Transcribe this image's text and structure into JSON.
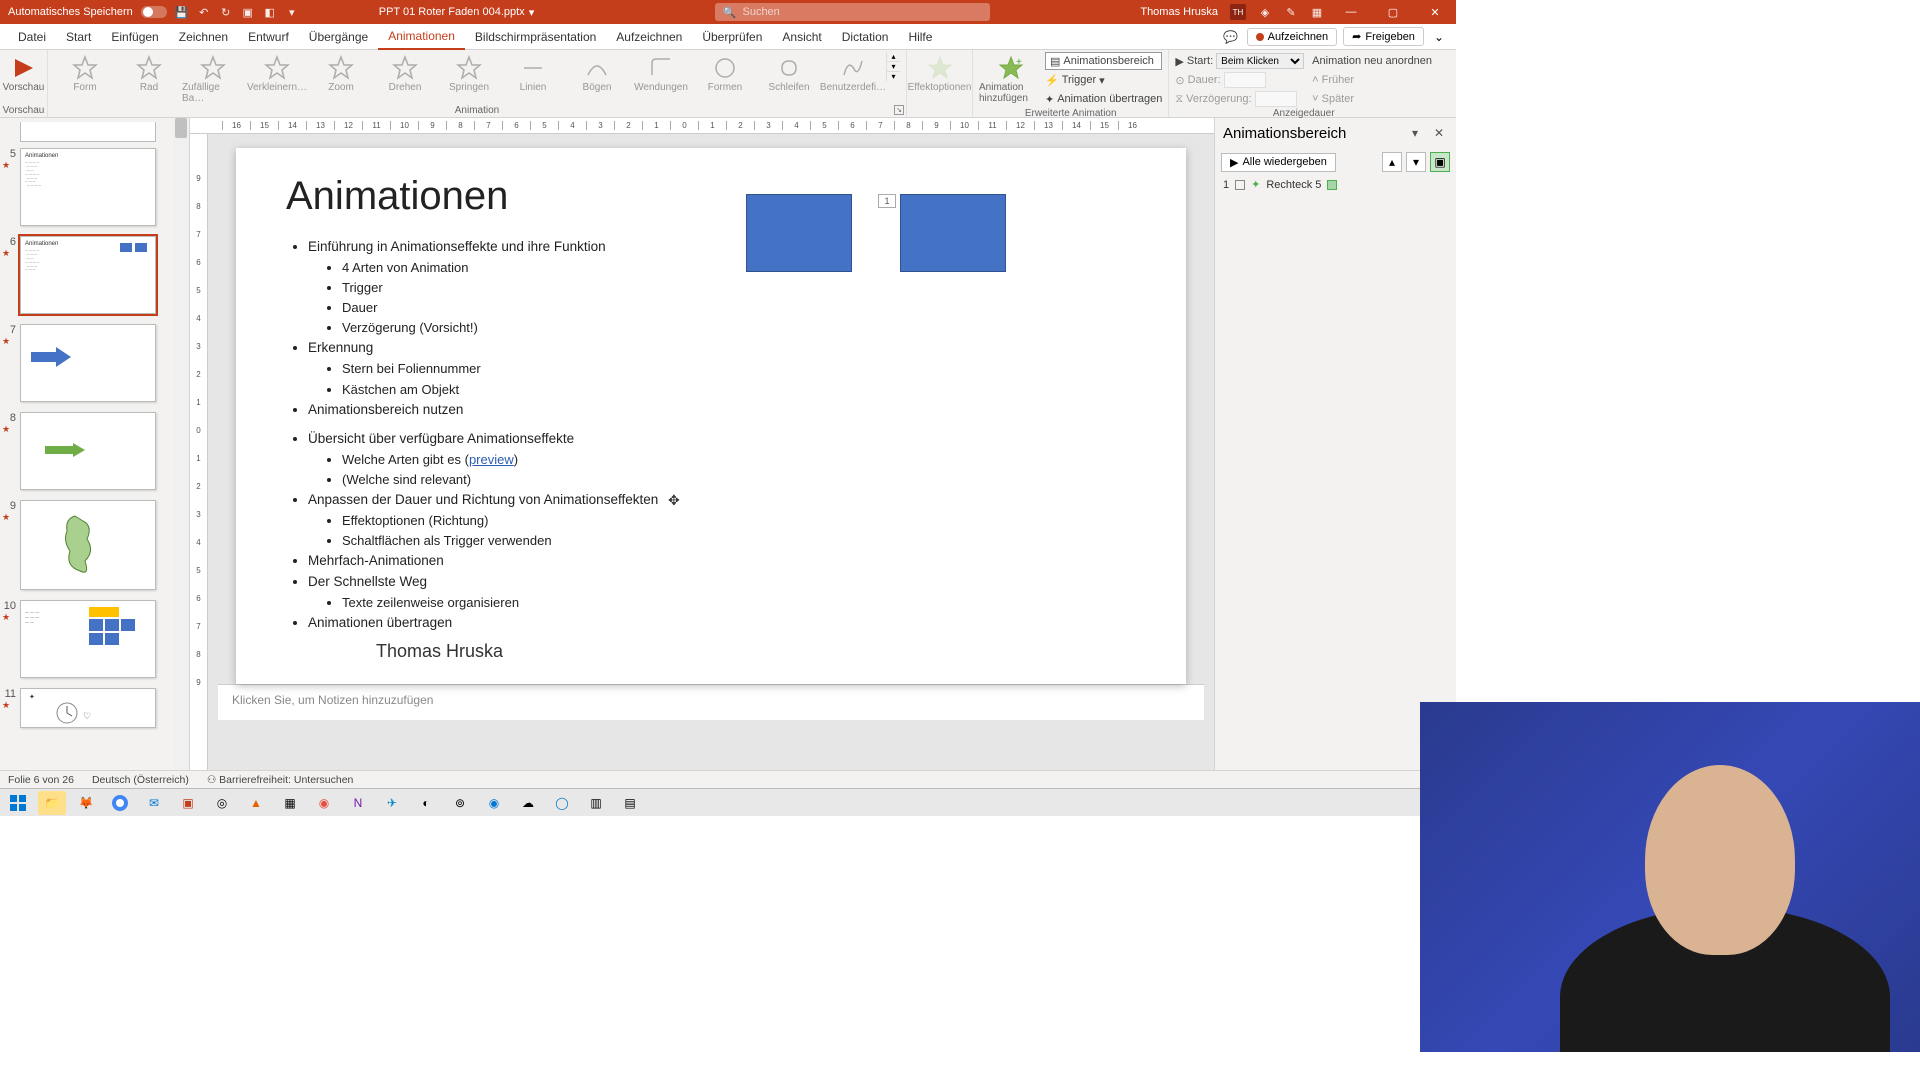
{
  "titlebar": {
    "autosave": "Automatisches Speichern",
    "filename": "PPT 01 Roter Faden 004.pptx",
    "search_placeholder": "Suchen",
    "user_name": "Thomas Hruska",
    "user_initials": "TH"
  },
  "menu": {
    "tabs": [
      "Datei",
      "Start",
      "Einfügen",
      "Zeichnen",
      "Entwurf",
      "Übergänge",
      "Animationen",
      "Bildschirmpräsentation",
      "Aufzeichnen",
      "Überprüfen",
      "Ansicht",
      "Dictation",
      "Hilfe"
    ],
    "active_index": 6,
    "record": "Aufzeichnen",
    "share": "Freigeben"
  },
  "ribbon": {
    "preview": {
      "btn": "Vorschau",
      "group": "Vorschau"
    },
    "animation_group": "Animation",
    "effects": [
      "Form",
      "Rad",
      "Zufällige Ba…",
      "Verkleinern…",
      "Zoom",
      "Drehen",
      "Springen",
      "Linien",
      "Bögen",
      "Wendungen",
      "Formen",
      "Schleifen",
      "Benutzerdefi…"
    ],
    "effect_options": "Effektoptionen",
    "advanced_group": "Erweiterte Animation",
    "add_anim": "Animation hinzufügen",
    "anim_pane": "Animationsbereich",
    "trigger": "Trigger",
    "transfer": "Animation übertragen",
    "timing_group": "Anzeigedauer",
    "start_lbl": "Start:",
    "start_val": "Beim Klicken",
    "duration_lbl": "Dauer:",
    "delay_lbl": "Verzögerung:",
    "reorder": "Animation neu anordnen",
    "earlier": "Früher",
    "later": "Später"
  },
  "thumbs": [
    {
      "num": "5",
      "star": true
    },
    {
      "num": "6",
      "star": true,
      "active": true
    },
    {
      "num": "7",
      "star": true
    },
    {
      "num": "8",
      "star": true
    },
    {
      "num": "9",
      "star": true
    },
    {
      "num": "10",
      "star": true
    },
    {
      "num": "11",
      "star": true
    }
  ],
  "thumb_content": {
    "5_title": "Animationen",
    "6_title": "Animationen"
  },
  "ruler_h": [
    "16",
    "15",
    "14",
    "13",
    "12",
    "11",
    "10",
    "9",
    "8",
    "7",
    "6",
    "5",
    "4",
    "3",
    "2",
    "1",
    "0",
    "1",
    "2",
    "3",
    "4",
    "5",
    "6",
    "7",
    "8",
    "9",
    "10",
    "11",
    "12",
    "13",
    "14",
    "15",
    "16"
  ],
  "ruler_v": [
    "9",
    "8",
    "7",
    "6",
    "5",
    "4",
    "3",
    "2",
    "1",
    "0",
    "1",
    "2",
    "3",
    "4",
    "5",
    "6",
    "7",
    "8",
    "9"
  ],
  "slide": {
    "title": "Animationen",
    "b1": "Einführung in Animationseffekte und ihre Funktion",
    "b1a": "4 Arten von Animation",
    "b1b": "Trigger",
    "b1c": "Dauer",
    "b1d": "Verzögerung (Vorsicht!)",
    "b2": "Erkennung",
    "b2a": "Stern bei Foliennummer",
    "b2b": "Kästchen am Objekt",
    "b3": "Animationsbereich nutzen",
    "b4": "Übersicht über verfügbare Animationseffekte",
    "b4a_pre": "Welche Arten gibt es (",
    "b4a_link": "preview",
    "b4a_post": ")",
    "b4b": "(Welche sind relevant)",
    "b5": "Anpassen der Dauer und Richtung von Animationseffekten",
    "b5a": "Effektoptionen (Richtung)",
    "b5b": "Schaltflächen als Trigger verwenden",
    "b6": "Mehrfach-Animationen",
    "b7": "Der Schnellste Weg",
    "b7a": "Texte zeilenweise organisieren",
    "b8": "Animationen übertragen",
    "author": "Thomas Hruska",
    "tag": "1"
  },
  "notes": "Klicken Sie, um Notizen hinzuzufügen",
  "anim_pane": {
    "title": "Animationsbereich",
    "play_all": "Alle wiedergeben",
    "item_num": "1",
    "item_name": "Rechteck 5"
  },
  "status": {
    "slide": "Folie 6 von 26",
    "lang": "Deutsch (Österreich)",
    "access": "Barrierefreiheit: Untersuchen"
  }
}
